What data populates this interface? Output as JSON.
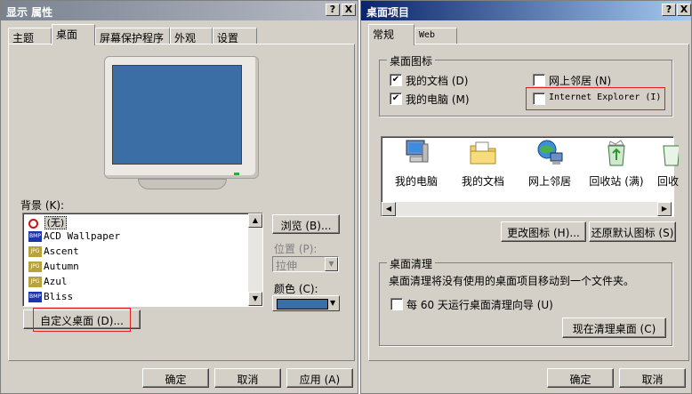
{
  "left": {
    "title": "显示 属性",
    "help_btn": "?",
    "close_btn": "X",
    "tabs": [
      "主题",
      "桌面",
      "屏幕保护程序",
      "外观",
      "设置"
    ],
    "background_label": "背景 (K):",
    "backgrounds": [
      "(无)",
      "ACD Wallpaper",
      "Ascent",
      "Autumn",
      "Azul",
      "Bliss"
    ],
    "browse_btn": "浏览 (B)...",
    "position_label": "位置 (P):",
    "position_value": "拉伸",
    "color_label": "颜色 (C):",
    "color_value": "#3a6ea5",
    "customize_btn": "自定义桌面 (D)...",
    "ok_btn": "确定",
    "cancel_btn": "取消",
    "apply_btn": "应用 (A)"
  },
  "right": {
    "title": "桌面项目",
    "help_btn": "?",
    "close_btn": "X",
    "tabs": [
      "常规",
      "Web"
    ],
    "icons_group": "桌面图标",
    "checkboxes": [
      {
        "label": "我的文档 (D)",
        "checked": true
      },
      {
        "label": "网上邻居 (N)",
        "checked": false
      },
      {
        "label": "我的电脑 (M)",
        "checked": true
      },
      {
        "label": "Internet Explorer (I)",
        "checked": false
      }
    ],
    "check_mark": "✔",
    "icons": [
      "我的电脑",
      "我的文档",
      "网上邻居",
      "回收站 (满)",
      "回收"
    ],
    "change_icon_btn": "更改图标 (H)...",
    "restore_btn": "还原默认图标 (S)",
    "cleanup_group": "桌面清理",
    "cleanup_text": "桌面清理将没有使用的桌面项目移动到一个文件夹。",
    "cleanup_check": "每 60 天运行桌面清理向导 (U)",
    "cleanup_btn": "现在清理桌面 (C)",
    "ok_btn": "确定",
    "cancel_btn": "取消"
  }
}
